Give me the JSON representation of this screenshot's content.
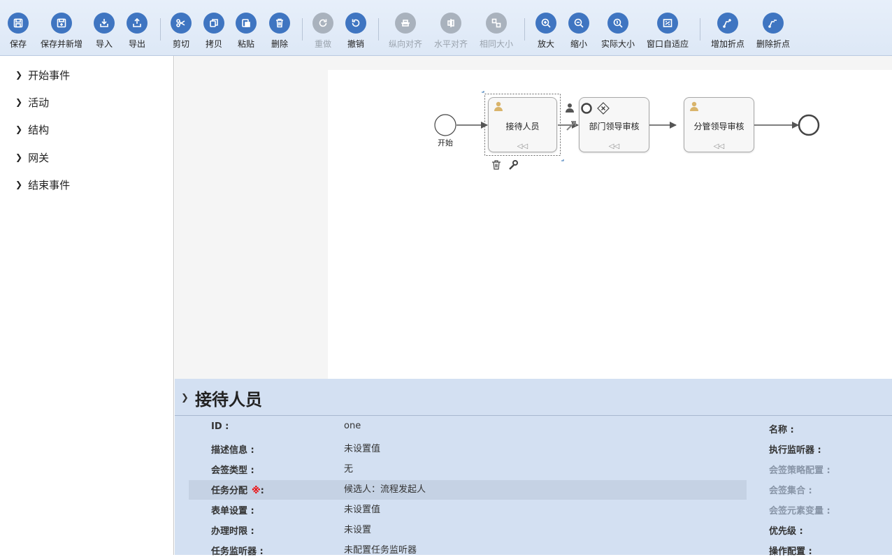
{
  "toolbar": {
    "save": "保存",
    "save_new": "保存并新增",
    "import": "导入",
    "export": "导出",
    "cut": "剪切",
    "copy": "拷贝",
    "paste": "粘贴",
    "delete": "删除",
    "redo": "重做",
    "undo": "撤销",
    "align_vertical": "纵向对齐",
    "align_horizontal": "水平对齐",
    "same_size": "相同大小",
    "zoom_in": "放大",
    "zoom_out": "缩小",
    "actual_size": "实际大小",
    "fit_window": "窗口自适应",
    "add_bend": "增加折点",
    "remove_bend": "删除折点"
  },
  "palette": {
    "items": [
      "开始事件",
      "活动",
      "结构",
      "网关",
      "结束事件"
    ]
  },
  "diagram": {
    "start_label": "开始",
    "nodes": [
      "接待人员",
      "部门领导审核",
      "分管领导审核"
    ]
  },
  "properties": {
    "title": "接待人员",
    "left": [
      {
        "label": "ID :",
        "value": "one"
      },
      {
        "label": "描述信息 :",
        "value": "未设置值"
      },
      {
        "label": "会签类型 :",
        "value": "无"
      },
      {
        "label": "任务分配",
        "required_mark": "※",
        "colon": ":",
        "value": "候选人：流程发起人"
      },
      {
        "label": "表单设置 :",
        "value": "未设置值"
      },
      {
        "label": "办理时限 :",
        "value": "未设置"
      },
      {
        "label": "任务监听器 :",
        "value": "未配置任务监听器"
      }
    ],
    "right": [
      {
        "label": "名称 :"
      },
      {
        "label": "执行监听器 :"
      },
      {
        "label": "会签策略配置 :"
      },
      {
        "label": "会签集合 :"
      },
      {
        "label": "会签元素变量 :"
      },
      {
        "label": "优先级 :"
      },
      {
        "label": "操作配置 :"
      }
    ]
  },
  "colors": {
    "toolbar_button": "#3f75c1",
    "toolbar_disabled": "#a9b2bd",
    "properties_bg": "#d3e0f2",
    "required": "#ee0000"
  }
}
